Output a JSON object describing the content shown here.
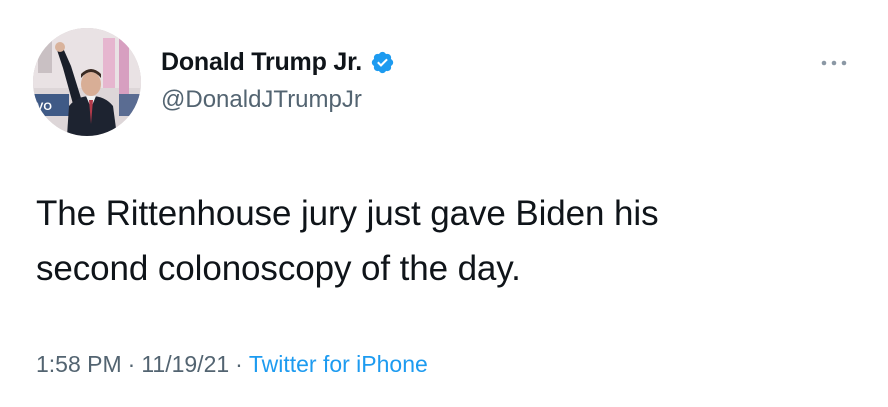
{
  "author": {
    "name": "Donald Trump Jr.",
    "handle": "@DonaldJTrumpJr",
    "verified": true,
    "avatar_icon": "profile-photo"
  },
  "tweet": {
    "lines": [
      "The Rittenhouse jury just gave Biden his",
      "second colonoscopy of the day."
    ]
  },
  "meta": {
    "time": "1:58 PM",
    "separator": "·",
    "date": "11/19/21",
    "source": "Twitter for iPhone"
  },
  "colors": {
    "text": "#0f1419",
    "secondary": "#536471",
    "link": "#1d9bf0"
  },
  "icons": {
    "verified": "verified-badge-icon",
    "more": "more-dots-icon"
  }
}
